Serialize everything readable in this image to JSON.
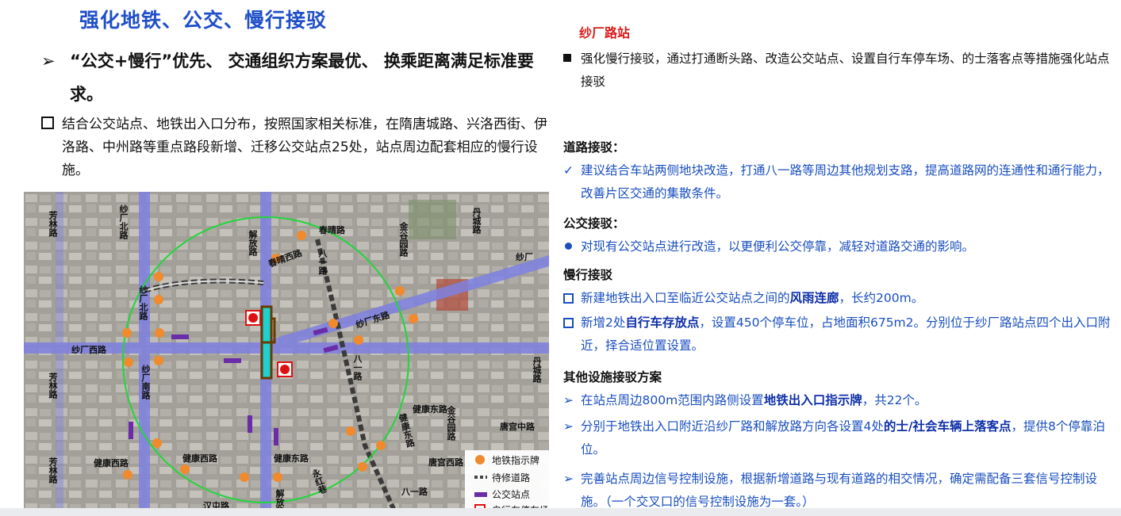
{
  "left": {
    "title": "强化地铁、公交、慢行接驳",
    "bullet1": {
      "marker": "➢",
      "text": "“公交+慢行”优先、  交通组织方案最优、  换乘距离满足标准要求。"
    },
    "bullet2": {
      "text": "结合公交站点、地铁出入口分布，按照国家相关标准，在隋唐城路、兴洛西街、伊洛路、中州路等重点路段新增、迁移公交站点25处，站点周边配套相应的慢行设施。"
    }
  },
  "map": {
    "labels": [
      {
        "text": "芳林路",
        "key": "fanglin1"
      },
      {
        "text": "纱厂北路",
        "key": "shabei1"
      },
      {
        "text": "解放路",
        "key": "jiefang"
      },
      {
        "text": "春晴路",
        "key": "chunqing"
      },
      {
        "text": "金谷园路",
        "key": "jingu"
      },
      {
        "text": "丹城路",
        "key": "dancheng"
      },
      {
        "text": "纱厂",
        "key": "shachang"
      },
      {
        "text": "春晴西路",
        "key": "chunqingxi"
      },
      {
        "text": "八一路",
        "key": "bayi1"
      },
      {
        "text": "纱厂北路",
        "key": "shabei2"
      },
      {
        "text": "纱厂东路",
        "key": "shadong"
      },
      {
        "text": "纱厂西路",
        "key": "shaxi"
      },
      {
        "text": "芳林路",
        "key": "fanglin2"
      },
      {
        "text": "纱厂南路",
        "key": "shanan"
      },
      {
        "text": "八一路",
        "key": "bayi2"
      },
      {
        "text": "丹城路",
        "key": "dancheng2"
      },
      {
        "text": "健康东路",
        "key": "jiankangdong1"
      },
      {
        "text": "金谷园路",
        "key": "jingu2"
      },
      {
        "text": "唐宫中路",
        "key": "tanggong"
      },
      {
        "text": "健康西路",
        "key": "jiankangxi1"
      },
      {
        "text": "健康东路",
        "key": "jiankangdong2"
      },
      {
        "text": "唐宫西路",
        "key": "tanggongxi"
      },
      {
        "text": "芳林路",
        "key": "fanglin3"
      },
      {
        "text": "健康西路",
        "key": "jiankangxi2"
      },
      {
        "text": "健康东路",
        "key": "jiankangdong3"
      },
      {
        "text": "八一路",
        "key": "bayi3"
      },
      {
        "text": "汉屯路",
        "key": "hantun"
      },
      {
        "text": "解放路",
        "key": "jiefang2"
      },
      {
        "text": "永红巷",
        "key": "yonghong"
      }
    ],
    "legend": [
      {
        "text": "地铁指示牌",
        "icon": "orange-dot"
      },
      {
        "text": "待修道路",
        "icon": "dash-line"
      },
      {
        "text": "公交站点",
        "icon": "purple-bar"
      },
      {
        "text": "自行车停车场",
        "icon": "bike-sign"
      }
    ],
    "colors": {
      "orange": "#f08a2c",
      "purple": "#6a2ca8",
      "road": "#7e80e0",
      "circle": "#22d63a"
    }
  },
  "right": {
    "station": "纱厂路站",
    "intro": "强化慢行接驳，通过打通断头路、改造公交站点、设置自行车停车场、的士落客点等措施强化站点接驳",
    "road_header": "道路接驳：",
    "road_item": "建议结合车站两侧地块改造，打通八一路等周边其他规划支路，提高道路网的连通性和通行能力，改善片区交通的集散条件。",
    "bus_header": "公交接驳：",
    "bus_item": "对现有公交站点进行改造，以更便利公交停靠，减轻对道路交通的影响。",
    "slow_header": "慢行接驳",
    "slow_item1_pre": "新建地铁出入口至临近公交站点之间的",
    "slow_item1_bold": "风雨连廊",
    "slow_item1_post": "，长约200m。",
    "slow_item2_pre": "新增2处",
    "slow_item2_bold": "自行车存放点",
    "slow_item2_post": "，设置450个停车位，占地面积675m2。分别位于纱厂路站点四个出入口附近，择合适位置设置。",
    "other_header": "其他设施接驳方案",
    "other_item1_pre": "在站点周边800m范围内路侧设置",
    "other_item1_bold": "地铁出入口指示牌",
    "other_item1_post": "，共22个。",
    "other_item2_pre": "分别于地铁出入口附近沿纱厂路和解放路方向各设置4处",
    "other_item2_bold": "的士/社会车辆上落客点",
    "other_item2_post": "，提供8个停靠泊位。",
    "other_item3": "完善站点周边信号控制设施，根据新增道路与现有道路的相交情况，确定需配备三套信号控制设施。（一个交叉口的信号控制设施为一套。）"
  }
}
